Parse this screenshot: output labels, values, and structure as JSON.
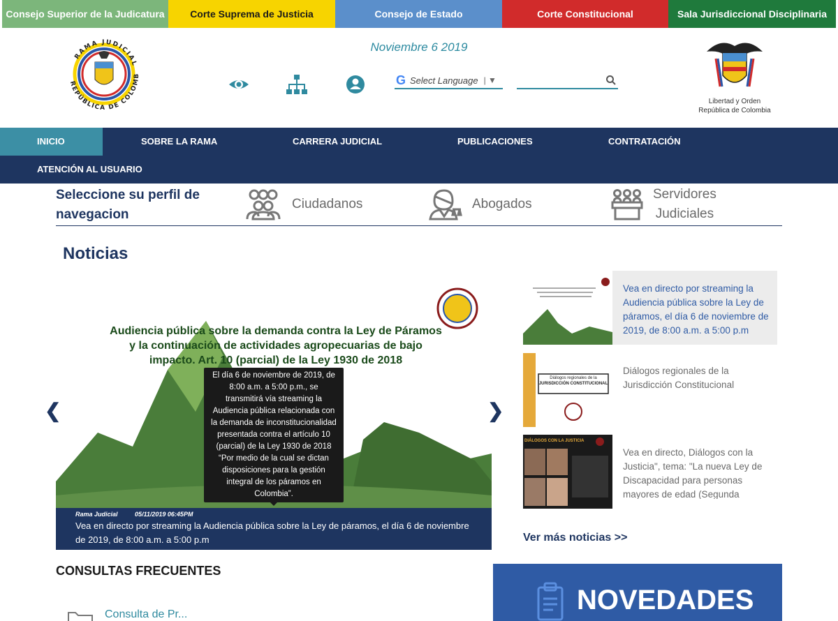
{
  "topbar": [
    {
      "label": "Consejo Superior de la Judicatura",
      "color": "#7cb67b"
    },
    {
      "label": "Corte Suprema de Justicia",
      "color": "#f7d400"
    },
    {
      "label": "Consejo de Estado",
      "color": "#5b8fcb"
    },
    {
      "label": "Corte Constitucional",
      "color": "#d12b2b"
    },
    {
      "label": "Sala Jurisdiccional Disciplinaria",
      "color": "#1f7a3c"
    }
  ],
  "header": {
    "date": "Noviembre 6 2019",
    "left_logo_text": "RAMA JUDICIAL · REPÚBLICA DE COLOMBIA",
    "language_label": "Select Language",
    "search_placeholder": "",
    "right_logo_line1": "Libertad y Orden",
    "right_logo_line2": "República de Colombia",
    "icons": [
      "eye-icon",
      "sitemap-icon",
      "user-icon"
    ]
  },
  "nav": {
    "items": [
      "INICIO",
      "SOBRE LA RAMA",
      "CARRERA JUDICIAL",
      "PUBLICACIONES",
      "CONTRATACIÓN",
      "ATENCIÓN AL USUARIO"
    ],
    "active": "INICIO"
  },
  "profile": {
    "title_line1": "Seleccione su perfil de",
    "title_line2": "navegacion",
    "options": [
      "Ciudadanos",
      "Abogados",
      "Servidores",
      "Judiciales"
    ]
  },
  "news": {
    "heading": "Noticias",
    "slide": {
      "headline_line1": "Audiencia pública sobre la demanda contra la Ley de Páramos",
      "headline_line2": "y la continuación de actividades agropecuarias de bajo",
      "headline_line3": "impacto. Art. 10 (parcial) de la Ley 1930 de 2018",
      "tooltip": "El día 6 de noviembre de 2019, de 8:00 a.m. a 5:00 p.m., se transmitirá vía streaming la Audiencia pública relacionada con la demanda de inconstitucionalidad presentada contra el artículo 10 (parcial) de la Ley 1930 de 2018 “Por medio de la cual se dictan disposiciones para la gestión integral de los páramos en Colombia”.",
      "source": "Rama Judicial",
      "timestamp": "05/11/2019 06:45PM",
      "caption": "Vea en directo por streaming la Audiencia pública sobre la Ley de páramos, el día 6 de noviembre de 2019, de 8:00 a.m. a 5:00 p.m"
    },
    "list": [
      {
        "text": "Vea en directo por streaming la Audiencia pública sobre la Ley de páramos, el día 6 de noviembre de 2019, de 8:00 a.m. a 5:00 p.m",
        "highlighted": true
      },
      {
        "text": "Diálogos regionales de la Jurisdicción Constitucional",
        "highlighted": false
      },
      {
        "text": "Vea en directo, Diálogos con la Justicia\", tema: \"La nueva Ley de Discapacidad para personas mayores de edad (Segunda",
        "highlighted": false
      }
    ],
    "thumb2_line1": "Diálogos regionales de la",
    "thumb2_line2": "JURISDICCIÓN CONSTITUCIONAL",
    "thumb3_text": "DIÁLOGOS CON LA JUSTICIA",
    "more": "Ver más noticias >>"
  },
  "consultas": {
    "heading": "CONSULTAS FRECUENTES",
    "first_item": "Consulta de Pr..."
  },
  "novedades": {
    "label": "NOVEDADES",
    "background": "#2f5ba5"
  },
  "colors": {
    "navy": "#1e3560",
    "teal": "#2f8a9f",
    "active_nav": "#3c8fa5"
  }
}
